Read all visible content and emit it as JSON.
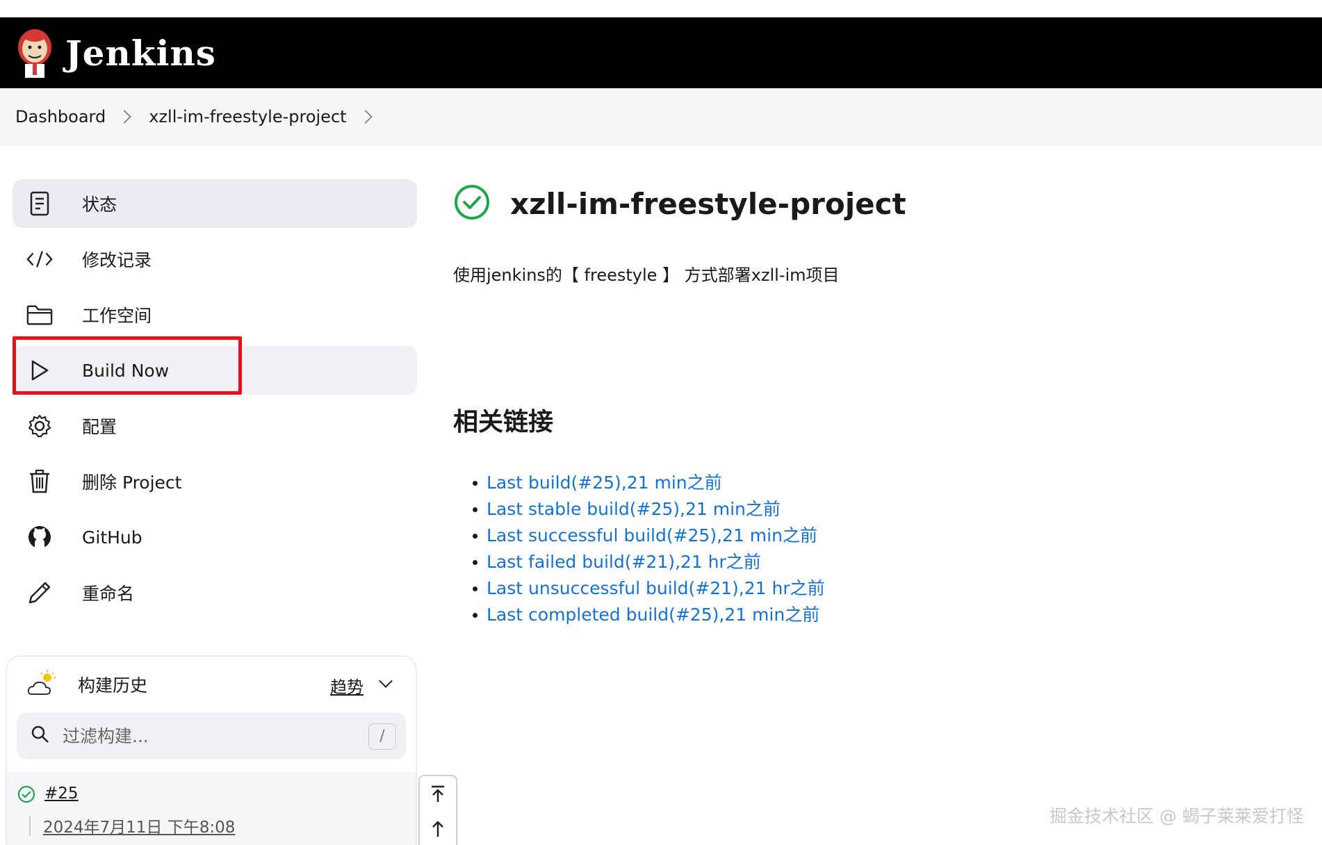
{
  "header": {
    "brand": "Jenkins"
  },
  "breadcrumb": [
    {
      "label": "Dashboard"
    },
    {
      "label": "xzll-im-freestyle-project"
    }
  ],
  "sidebar": {
    "items": [
      {
        "label": "状态",
        "icon": "document-icon"
      },
      {
        "label": "修改记录",
        "icon": "code-icon"
      },
      {
        "label": "工作空间",
        "icon": "folder-icon"
      },
      {
        "label": "Build Now",
        "icon": "play-icon"
      },
      {
        "label": "配置",
        "icon": "gear-icon"
      },
      {
        "label": "删除 Project",
        "icon": "trash-icon"
      },
      {
        "label": "GitHub",
        "icon": "github-icon"
      },
      {
        "label": "重命名",
        "icon": "pencil-icon"
      }
    ]
  },
  "build_history": {
    "title": "构建历史",
    "trend_label": "趋势",
    "filter_placeholder": "过滤构建...",
    "shortcut": "/",
    "builds": [
      {
        "number": "#25",
        "date": "2024年7月11日 下午8:08",
        "status": "success"
      }
    ]
  },
  "main": {
    "title": "xzll-im-freestyle-project",
    "description": "使用jenkins的【 freestyle 】 方式部署xzll-im项目",
    "related_heading": "相关链接",
    "links": [
      "Last build(#25),21 min之前",
      "Last stable build(#25),21 min之前",
      "Last successful build(#25),21 min之前",
      "Last failed build(#21),21 hr之前",
      "Last unsuccessful build(#21),21 hr之前",
      "Last completed build(#25),21 min之前"
    ]
  },
  "watermark": "掘金技术社区 @ 蝎子莱莱爱打怪",
  "colors": {
    "header_bg": "#000000",
    "link": "#1272d8",
    "success": "#1ea64a",
    "highlight": "#e8101a"
  }
}
